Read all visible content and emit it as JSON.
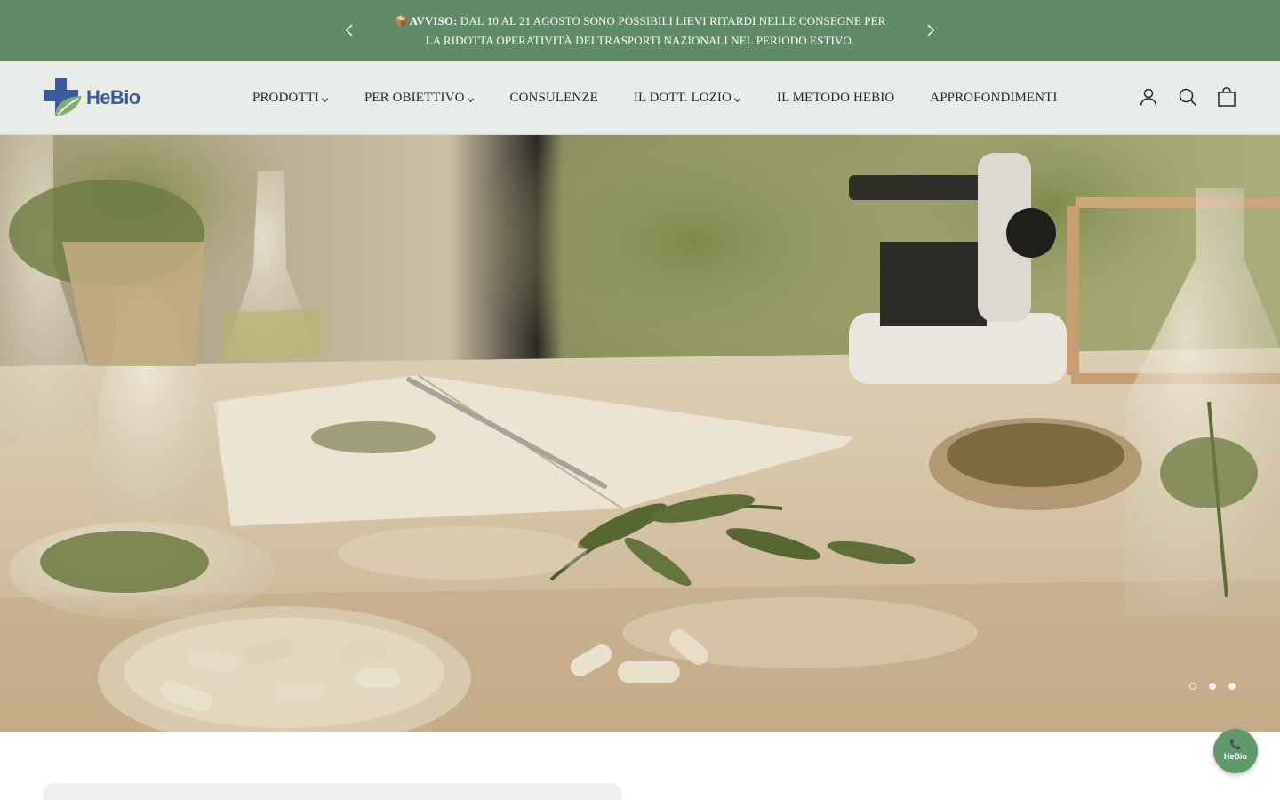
{
  "announcement": {
    "icon": "package-icon",
    "icon_glyph": "📦",
    "bold": "AVVISO:",
    "text": " DAL 10 AL 21 AGOSTO SONO POSSIBILI LIEVI RITARDI NELLE CONSEGNE PER LA RIDOTTA OPERATIVITÀ DEI TRASPORTI NAZIONALI NEL PERIODO ESTIVO.",
    "background": "#5f8c66"
  },
  "brand": {
    "name": "HeBio",
    "primary_color": "#3a5a9c",
    "accent_color": "#7fb069"
  },
  "nav": {
    "items": [
      {
        "label": "PRODOTTI",
        "has_dropdown": true
      },
      {
        "label": "PER OBIETTIVO",
        "has_dropdown": true
      },
      {
        "label": "CONSULENZE",
        "has_dropdown": false
      },
      {
        "label": "IL DOTT. LOZIO",
        "has_dropdown": true
      },
      {
        "label": "IL METODO HEBIO",
        "has_dropdown": false
      },
      {
        "label": "APPROFONDIMENTI",
        "has_dropdown": false
      }
    ]
  },
  "header_icons": [
    "account-icon",
    "search-icon",
    "cart-icon"
  ],
  "hero": {
    "slide_count": 3,
    "active_slide": 1,
    "scene": "laboratory table with glassware, microscope, herbs, open notebook and capsules"
  },
  "chat": {
    "icon": "phone-icon",
    "glyph": "📞",
    "label": "HeBio",
    "color": "#5f9a6a"
  }
}
